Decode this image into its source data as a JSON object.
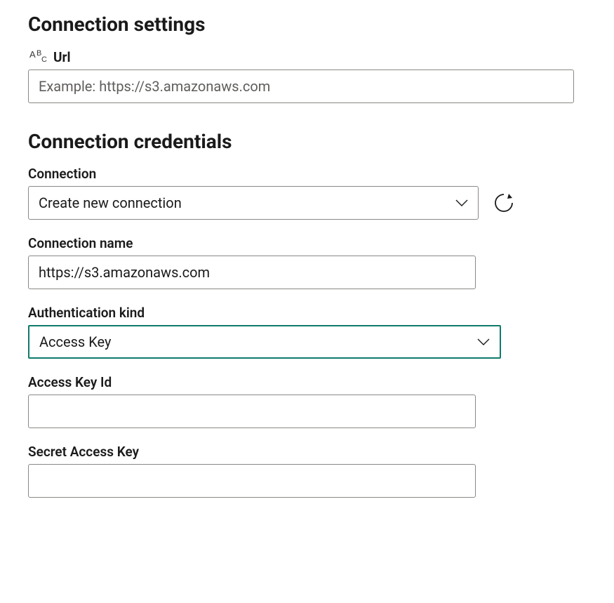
{
  "settings": {
    "heading": "Connection settings",
    "url": {
      "label": "Url",
      "placeholder": "Example: https://s3.amazonaws.com",
      "value": ""
    }
  },
  "credentials": {
    "heading": "Connection credentials",
    "connection": {
      "label": "Connection",
      "selected": "Create new connection"
    },
    "connection_name": {
      "label": "Connection name",
      "value": "https://s3.amazonaws.com"
    },
    "auth_kind": {
      "label": "Authentication kind",
      "selected": "Access Key"
    },
    "access_key_id": {
      "label": "Access Key Id",
      "value": ""
    },
    "secret_access_key": {
      "label": "Secret Access Key",
      "value": ""
    }
  }
}
